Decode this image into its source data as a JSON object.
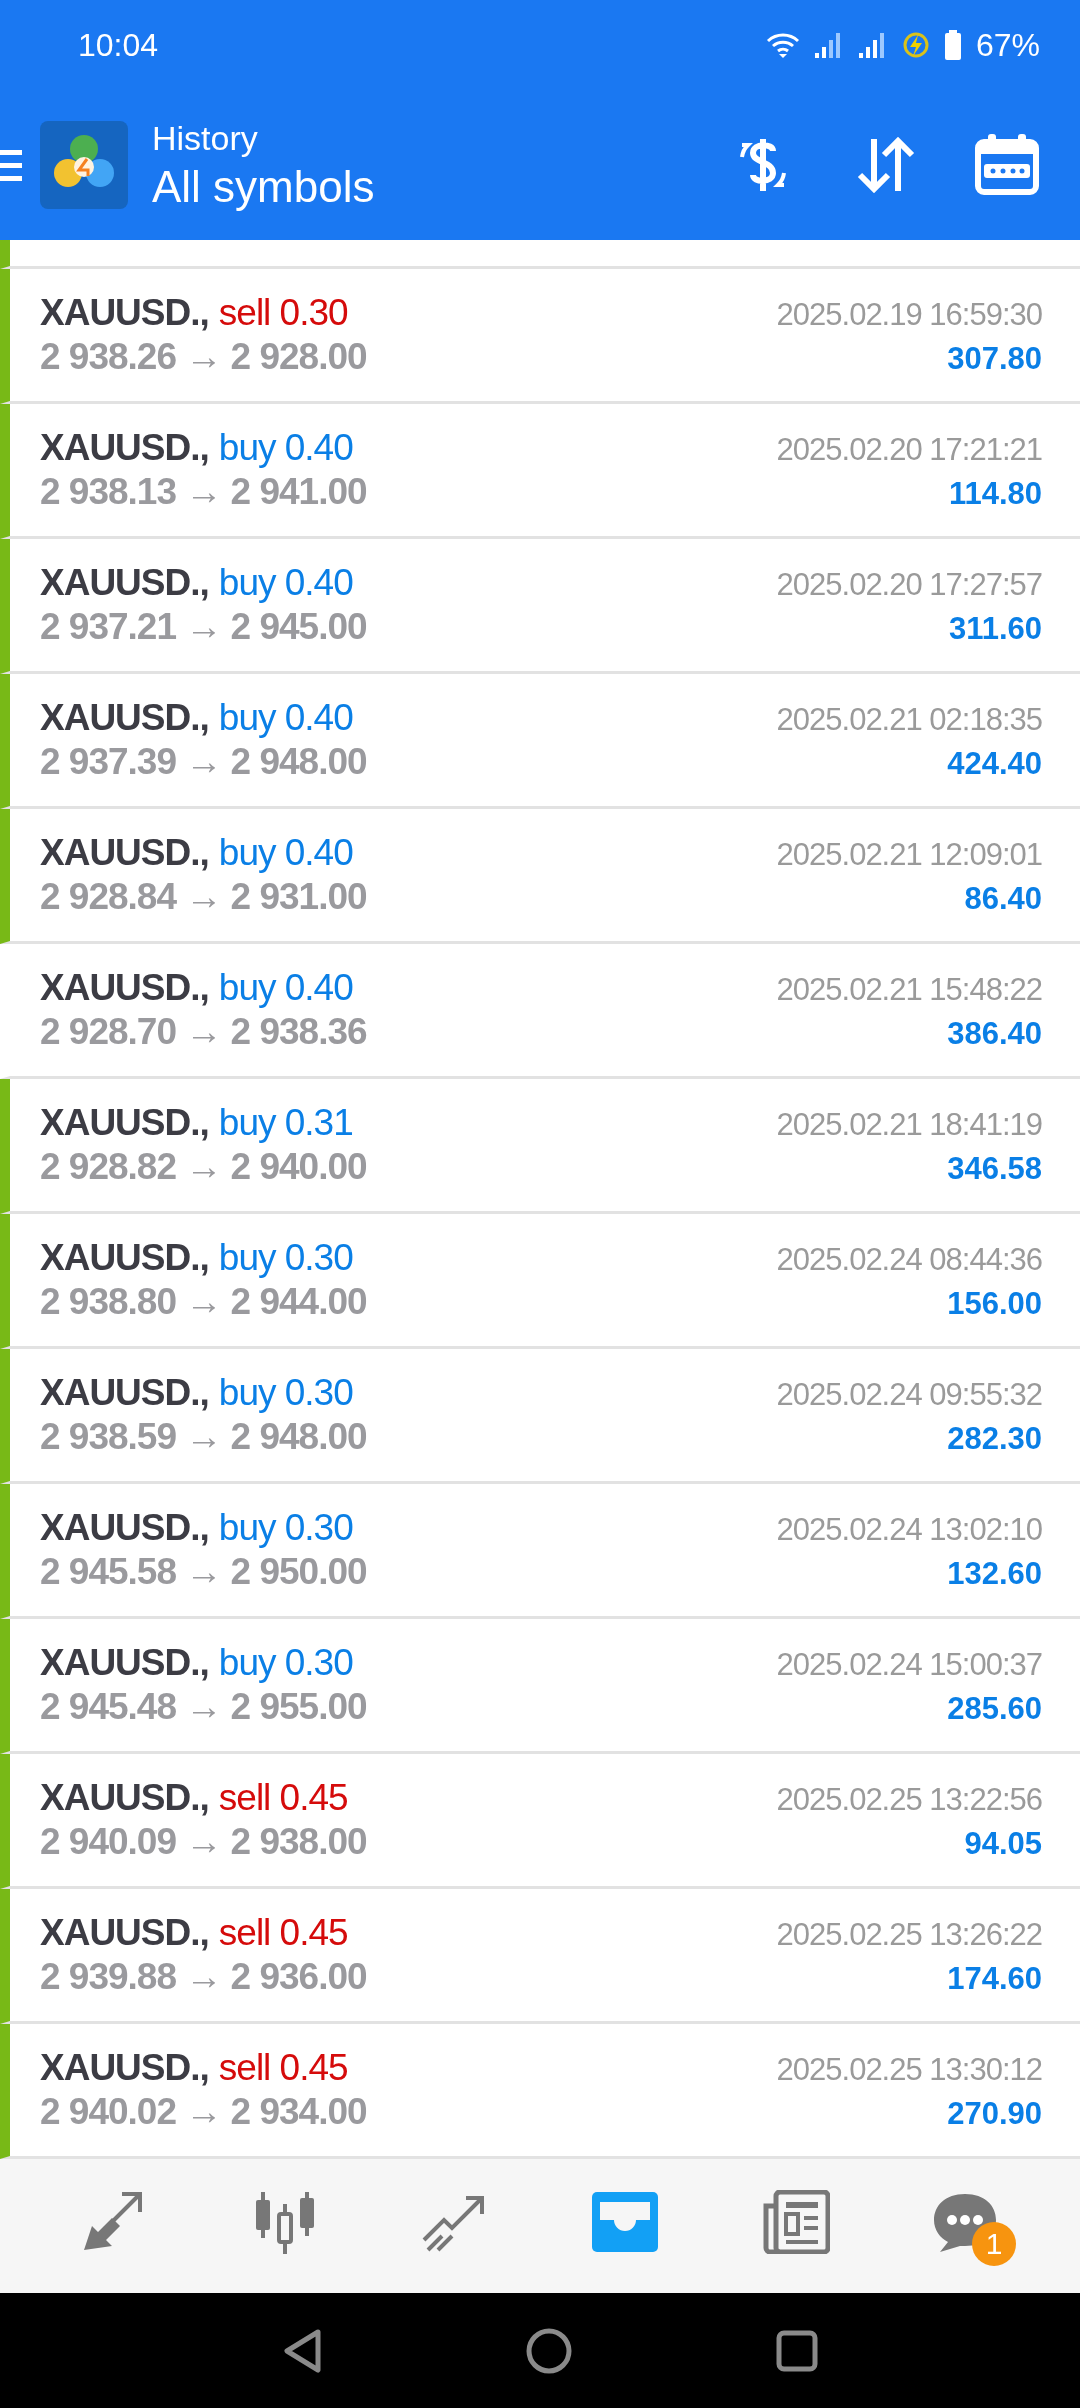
{
  "status_bar": {
    "time": "10:04",
    "battery": "67%"
  },
  "header": {
    "title": "History",
    "subtitle": "All symbols"
  },
  "deals": [
    {
      "symbol": "XAUUSD.,",
      "kind": "sell",
      "deal": "sell 0.30",
      "prices": "2 938.26 → 2 928.00",
      "time": "2025.02.19 16:59:30",
      "profit": "307.80",
      "marked": true
    },
    {
      "symbol": "XAUUSD.,",
      "kind": "buy",
      "deal": "buy 0.40",
      "prices": "2 938.13 → 2 941.00",
      "time": "2025.02.20 17:21:21",
      "profit": "114.80",
      "marked": true
    },
    {
      "symbol": "XAUUSD.,",
      "kind": "buy",
      "deal": "buy 0.40",
      "prices": "2 937.21 → 2 945.00",
      "time": "2025.02.20 17:27:57",
      "profit": "311.60",
      "marked": true
    },
    {
      "symbol": "XAUUSD.,",
      "kind": "buy",
      "deal": "buy 0.40",
      "prices": "2 937.39 → 2 948.00",
      "time": "2025.02.21 02:18:35",
      "profit": "424.40",
      "marked": true
    },
    {
      "symbol": "XAUUSD.,",
      "kind": "buy",
      "deal": "buy 0.40",
      "prices": "2 928.84 → 2 931.00",
      "time": "2025.02.21 12:09:01",
      "profit": "86.40",
      "marked": true
    },
    {
      "symbol": "XAUUSD.,",
      "kind": "buy",
      "deal": "buy 0.40",
      "prices": "2 928.70 → 2 938.36",
      "time": "2025.02.21 15:48:22",
      "profit": "386.40",
      "marked": false
    },
    {
      "symbol": "XAUUSD.,",
      "kind": "buy",
      "deal": "buy 0.31",
      "prices": "2 928.82 → 2 940.00",
      "time": "2025.02.21 18:41:19",
      "profit": "346.58",
      "marked": true
    },
    {
      "symbol": "XAUUSD.,",
      "kind": "buy",
      "deal": "buy 0.30",
      "prices": "2 938.80 → 2 944.00",
      "time": "2025.02.24 08:44:36",
      "profit": "156.00",
      "marked": true
    },
    {
      "symbol": "XAUUSD.,",
      "kind": "buy",
      "deal": "buy 0.30",
      "prices": "2 938.59 → 2 948.00",
      "time": "2025.02.24 09:55:32",
      "profit": "282.30",
      "marked": true
    },
    {
      "symbol": "XAUUSD.,",
      "kind": "buy",
      "deal": "buy 0.30",
      "prices": "2 945.58 → 2 950.00",
      "time": "2025.02.24 13:02:10",
      "profit": "132.60",
      "marked": true
    },
    {
      "symbol": "XAUUSD.,",
      "kind": "buy",
      "deal": "buy 0.30",
      "prices": "2 945.48 → 2 955.00",
      "time": "2025.02.24 15:00:37",
      "profit": "285.60",
      "marked": true
    },
    {
      "symbol": "XAUUSD.,",
      "kind": "sell",
      "deal": "sell 0.45",
      "prices": "2 940.09 → 2 938.00",
      "time": "2025.02.25 13:22:56",
      "profit": "94.05",
      "marked": true
    },
    {
      "symbol": "XAUUSD.,",
      "kind": "sell",
      "deal": "sell 0.45",
      "prices": "2 939.88 → 2 936.00",
      "time": "2025.02.25 13:26:22",
      "profit": "174.60",
      "marked": true
    },
    {
      "symbol": "XAUUSD.,",
      "kind": "sell",
      "deal": "sell 0.45",
      "prices": "2 940.02 → 2 934.00",
      "time": "2025.02.25 13:30:12",
      "profit": "270.90",
      "marked": true
    }
  ],
  "nav": [
    {
      "kind": "quotes",
      "selected": false
    },
    {
      "kind": "chart",
      "selected": false
    },
    {
      "kind": "trade",
      "selected": false
    },
    {
      "kind": "history",
      "selected": true
    },
    {
      "kind": "news",
      "selected": false
    },
    {
      "kind": "chat",
      "selected": false,
      "badge": "1"
    }
  ]
}
